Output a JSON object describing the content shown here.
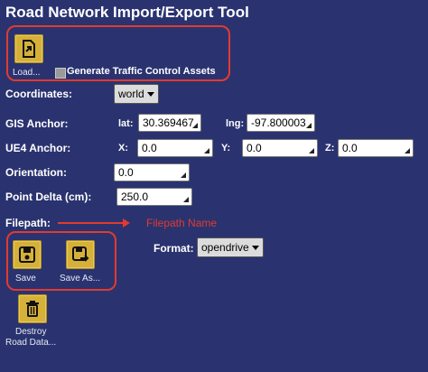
{
  "window": {
    "title": "Road Network Import/Export Tool"
  },
  "load": {
    "label": "Load...",
    "icon": "load-file-icon"
  },
  "traffic": {
    "label": "Generate Traffic Control Assets",
    "checked": false
  },
  "coordinates": {
    "label": "Coordinates:",
    "value": "world"
  },
  "gis": {
    "label": "GIS Anchor:",
    "lat_label": "lat:",
    "lat_value": "30.369467",
    "lng_label": "lng:",
    "lng_value": "-97.800003"
  },
  "ue4": {
    "label": "UE4 Anchor:",
    "x_label": "X:",
    "x_value": "0.0",
    "y_label": "Y:",
    "y_value": "0.0",
    "z_label": "Z:",
    "z_value": "0.0"
  },
  "orientation": {
    "label": "Orientation:",
    "value": "0.0"
  },
  "point_delta": {
    "label": "Point Delta (cm):",
    "value": "250.0"
  },
  "filepath": {
    "label": "Filepath:",
    "annotation": "Filepath Name"
  },
  "format": {
    "label": "Format:",
    "value": "opendrive"
  },
  "save": {
    "label": "Save",
    "icon": "save-icon"
  },
  "save_as": {
    "label": "Save As...",
    "icon": "save-as-icon"
  },
  "destroy": {
    "label_line1": "Destroy",
    "label_line2": "Road Data...",
    "icon": "trash-icon"
  },
  "colors": {
    "background": "#2a3370",
    "accent": "#d6b13a",
    "annotation": "#e23b2e"
  }
}
